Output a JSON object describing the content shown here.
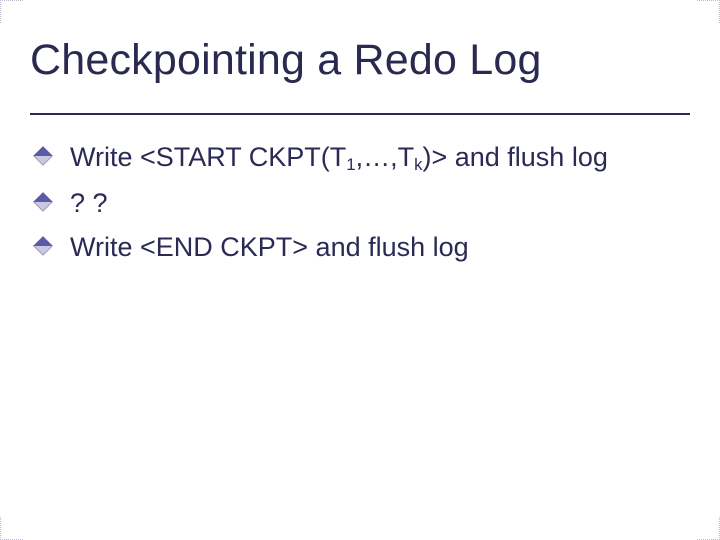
{
  "slide": {
    "title": "Checkpointing a Redo Log",
    "items": [
      {
        "prefix": "Write <START CKPT(T",
        "sub1": "1",
        "mid": ",…,T",
        "sub2": "k",
        "suffix": ")> and flush log"
      },
      {
        "text": " ? ?"
      },
      {
        "text": "Write <END CKPT> and flush log"
      }
    ]
  }
}
